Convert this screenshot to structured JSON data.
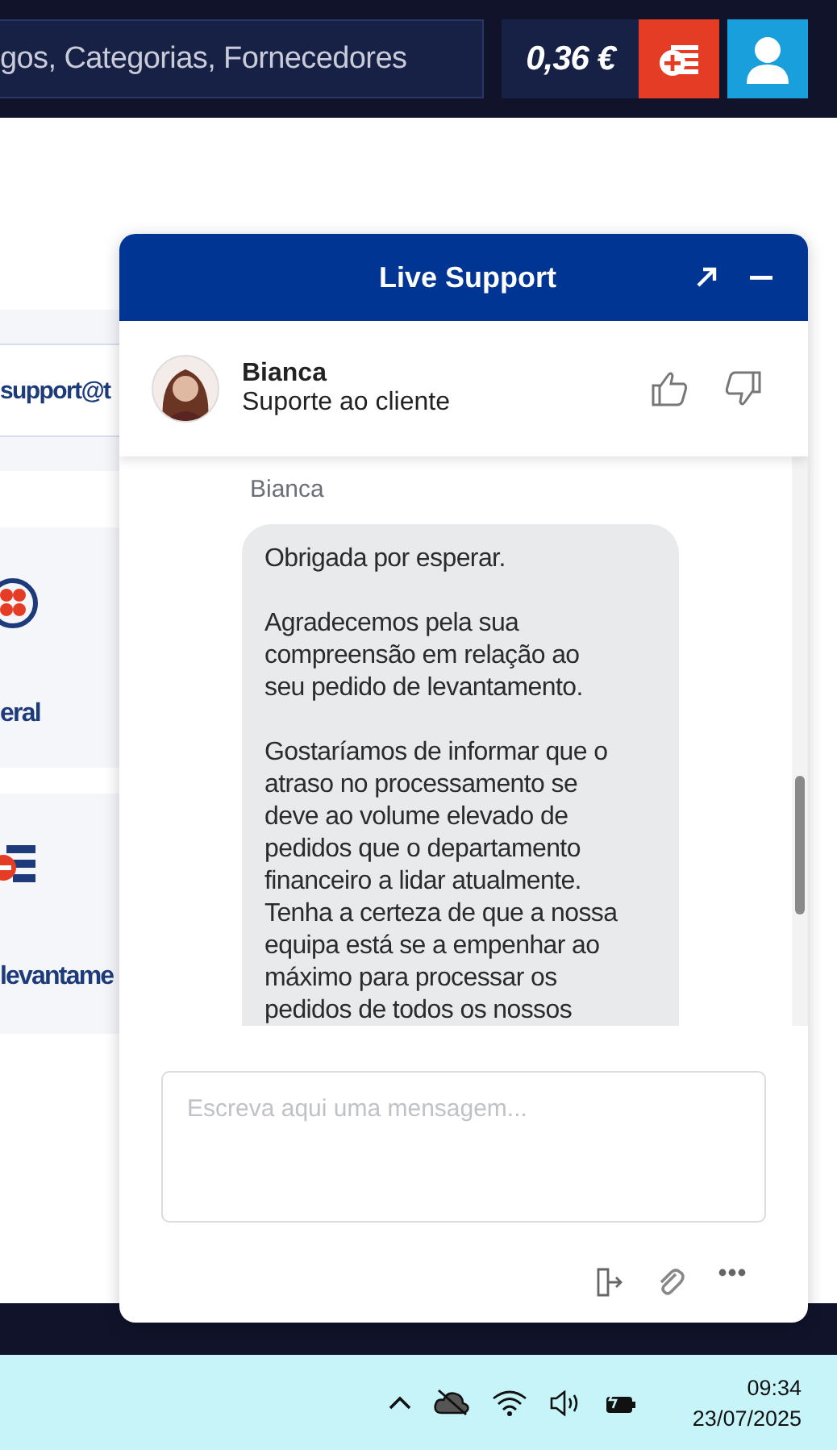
{
  "top_bar": {
    "search": {
      "value": "gos, Categorias, Fornecedores"
    },
    "balance": "0,36 €"
  },
  "background": {
    "email": "support@t",
    "cards": [
      {
        "kind": "clover",
        "label": "eral"
      },
      {
        "kind": "withdraw",
        "label": "levantame"
      }
    ]
  },
  "chat": {
    "title": "Live Support",
    "agent": {
      "name": "Bianca",
      "role": "Suporte ao cliente"
    },
    "messages": [
      {
        "sender": "Bianca",
        "paragraphs": [
          "Obrigada por esperar.",
          "Agradecemos pela sua\ncompreensão em relação ao\nseu pedido de levantamento.",
          "Gostaríamos de informar que o\natraso no processamento se\ndeve ao volume elevado de\npedidos que o departamento\nfinanceiro a lidar atualmente.\nTenha a certeza de que a nossa\nequipa está se a empenhar ao\nmáximo para processar os\npedidos de todos os nossos"
        ]
      }
    ],
    "input": {
      "placeholder": "Escreva aqui uma mensagem..."
    }
  },
  "taskbar": {
    "time": "09:34",
    "date": "23/07/2025"
  }
}
